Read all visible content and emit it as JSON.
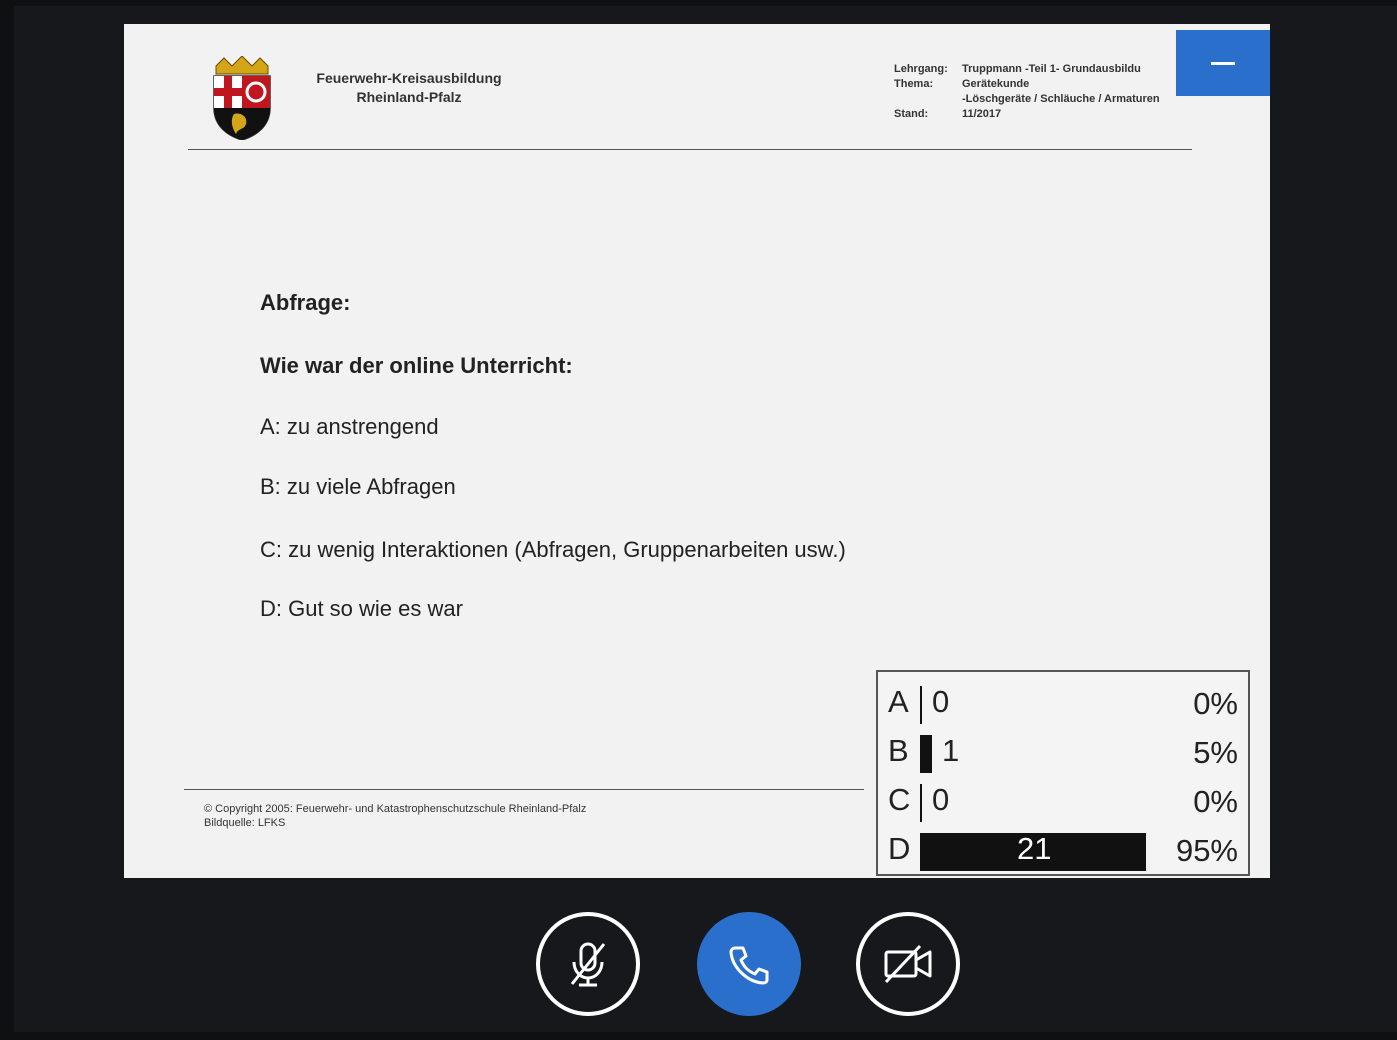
{
  "slide": {
    "org_line1": "Feuerwehr-Kreisausbildung",
    "org_line2": "Rheinland-Pfalz",
    "meta": [
      {
        "key": "Lehrgang:",
        "value": "Truppmann -Teil 1- Grundausbildu"
      },
      {
        "key": "Thema:",
        "value": "Gerätekunde"
      },
      {
        "key": "",
        "value": "-Löschgeräte / Schläuche / Armaturen"
      },
      {
        "key": "Stand:",
        "value": "11/2017"
      }
    ],
    "heading": "Abfrage:",
    "question": "Wie war der online Unterricht:",
    "options": [
      "A: zu anstrengend",
      "B: zu viele Abfragen",
      "C: zu wenig Interaktionen (Abfragen, Gruppenarbeiten usw.)",
      "D: Gut so wie es war"
    ],
    "copyright_line1": "© Copyright 2005: Feuerwehr- und Katastrophenschutzschule Rheinland-Pfalz",
    "copyright_line2": "Bildquelle: LFKS"
  },
  "poll": {
    "rows": [
      {
        "label": "A",
        "count": "0",
        "percent": "0%",
        "fraction": 0.0
      },
      {
        "label": "B",
        "count": "1",
        "percent": "5%",
        "fraction": 0.05
      },
      {
        "label": "C",
        "count": "0",
        "percent": "0%",
        "fraction": 0.0
      },
      {
        "label": "D",
        "count": "21",
        "percent": "95%",
        "fraction": 0.95
      }
    ]
  },
  "controls": {
    "mute_icon": "microphone-muted-icon",
    "call_icon": "phone-icon",
    "video_icon": "video-off-icon"
  },
  "colors": {
    "accent": "#2a6fcb",
    "background": "#0f1012",
    "slide": "#f2f2f2"
  }
}
